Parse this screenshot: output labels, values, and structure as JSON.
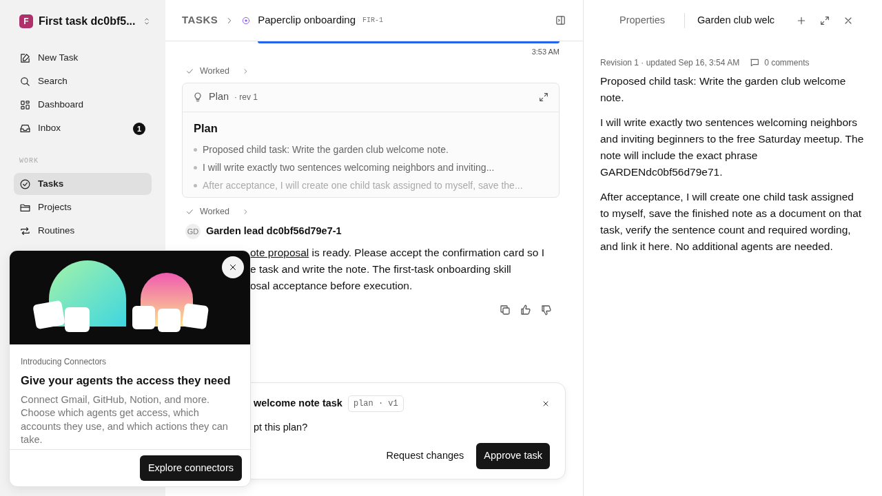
{
  "workspace": {
    "initial": "F",
    "name": "First task dc0bf5..."
  },
  "nav": [
    {
      "label": "New Task",
      "selected": false
    },
    {
      "label": "Search",
      "selected": false
    },
    {
      "label": "Dashboard",
      "selected": false
    },
    {
      "label": "Inbox",
      "badge": "1",
      "selected": false
    }
  ],
  "section": {
    "title": "WORK",
    "items": [
      {
        "label": "Tasks",
        "selected": true
      },
      {
        "label": "Projects",
        "selected": false
      },
      {
        "label": "Routines",
        "selected": false
      }
    ]
  },
  "header": {
    "crumb": "TASKS",
    "title": "Paperclip onboarding",
    "code": "FIR-1"
  },
  "feed": {
    "timestamp": "3:53 AM",
    "items": [
      {
        "kind": "worked",
        "label": "Worked"
      },
      {
        "kind": "plan",
        "title": "Plan",
        "rev": "· rev 1",
        "heading": "Plan",
        "bullets": [
          {
            "text": "Proposed child task: Write the garden club welcome note.",
            "faded": false
          },
          {
            "text": "I will write exactly two sentences welcoming neighbors and inviting...",
            "faded": false
          },
          {
            "text": "After acceptance, I will create one child task assigned to myself, save the...",
            "faded": true
          }
        ]
      },
      {
        "kind": "worked",
        "label": "Worked"
      },
      {
        "kind": "message",
        "avatar": "GD",
        "author": "Garden lead dc0bf56d79e7-1",
        "link": "ote proposal",
        "lines": [
          " is ready. Please accept the confirmation card so I",
          "e task and write the note. The first-task onboarding skill",
          "osal acceptance before execution."
        ]
      }
    ]
  },
  "approval": {
    "title": "welcome note task",
    "tag": "plan · v1",
    "question": "pt this plan?",
    "buttons": [
      {
        "label": "Request changes",
        "kind": "plain"
      },
      {
        "label": "Approve task",
        "kind": "primary"
      }
    ]
  },
  "panel": {
    "tabs": [
      {
        "label": "Properties",
        "selected": false
      },
      {
        "label": "Garden club welc",
        "selected": true
      }
    ],
    "meta": "Revision 1 · updated Sep 16, 3:54 AM",
    "comments": "0 comments",
    "paragraphs": [
      "Proposed child task: Write the garden club welcome note.",
      "I will write exactly two sentences welcoming neighbors and inviting beginners to the free Saturday meetup. The note will include the exact phrase GARDENdc0bf56d79e71.",
      "After acceptance, I will create one child task assigned to myself, save the finished note as a document on that task, verify the sentence count and required wording, and link it here. No additional agents are needed."
    ]
  },
  "popup": {
    "eyebrow": "Introducing Connectors",
    "title": "Give your agents the access they need",
    "body": "Connect Gmail, GitHub, Notion, and more. Choose which agents get access, which accounts they use, and which actions they can take.",
    "button": "Explore connectors"
  }
}
